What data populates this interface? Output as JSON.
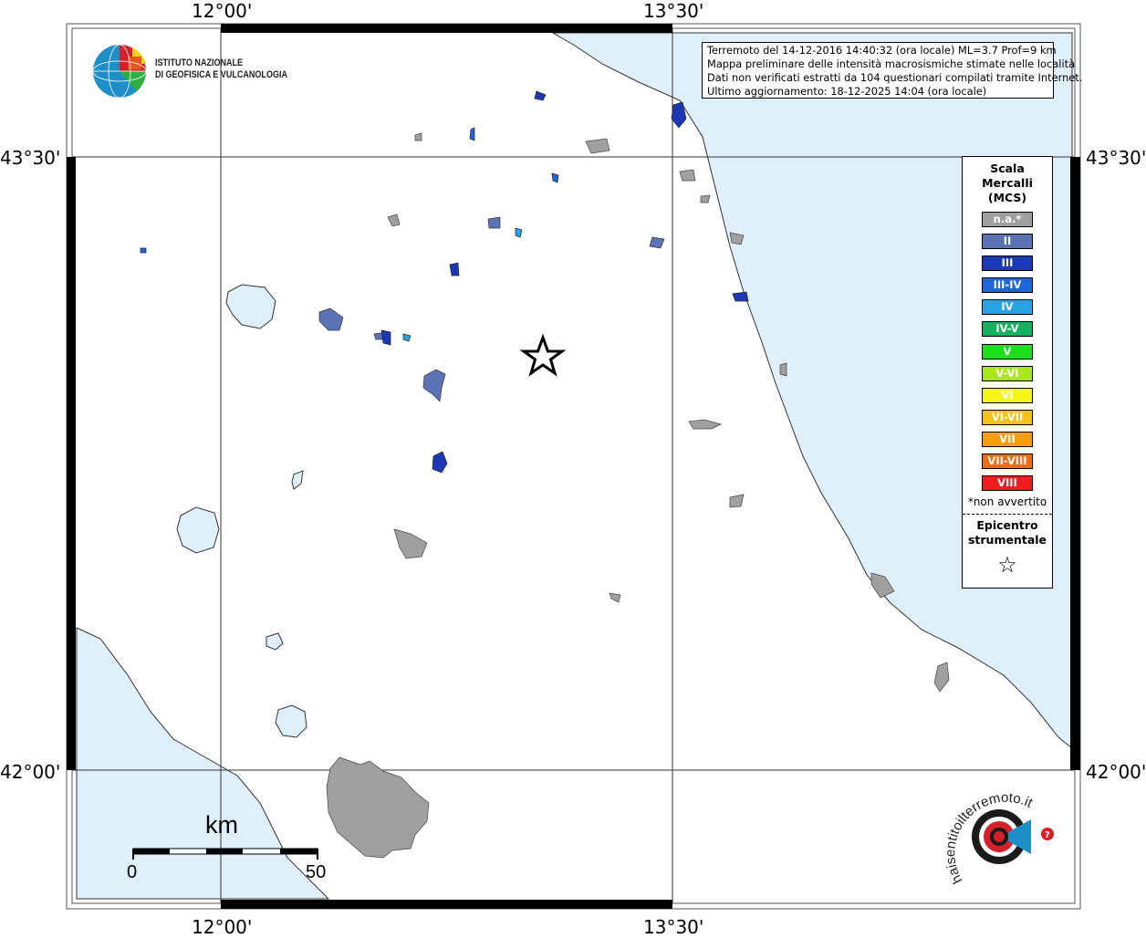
{
  "map": {
    "lon_labels": [
      "12°00'",
      "13°30'"
    ],
    "lat_labels": [
      "43°30'",
      "42°00'"
    ]
  },
  "info": {
    "lines": [
      "Terremoto del 14-12-2016 14:40:32 (ora locale) ML=3.7 Prof=9 km",
      "Mappa preliminare delle intensità macrosismiche stimate nelle località",
      "Dati non verificati estratti da 104 questionari compilati tramite Internet.",
      "Ultimo aggiornamento: 18-12-2025 14:04 (ora locale)"
    ]
  },
  "ingv": {
    "line1": "ISTITUTO NAZIONALE",
    "line2": "DI GEOFISICA E VULCANOLOGIA"
  },
  "legend": {
    "title": [
      "Scala",
      "Mercalli",
      "(MCS)"
    ],
    "items": [
      {
        "label": "n.a.*",
        "color": "#a0a0a0"
      },
      {
        "label": "II",
        "color": "#5b72b5"
      },
      {
        "label": "III",
        "color": "#1c38b4"
      },
      {
        "label": "III-IV",
        "color": "#1f66d6"
      },
      {
        "label": "IV",
        "color": "#2aa3e6"
      },
      {
        "label": "IV-V",
        "color": "#15b060"
      },
      {
        "label": "V",
        "color": "#1edc1e"
      },
      {
        "label": "V-VI",
        "color": "#aae61e"
      },
      {
        "label": "VI",
        "color": "#f5f51a"
      },
      {
        "label": "VI-VII",
        "color": "#f5c21a"
      },
      {
        "label": "VII",
        "color": "#f5a00a"
      },
      {
        "label": "VII-VIII",
        "color": "#f06c14"
      },
      {
        "label": "VIII",
        "color": "#f01e1e"
      }
    ],
    "note": "*non avvertito",
    "epicenter_label": [
      "Epicentro",
      "strumentale"
    ],
    "epicenter_symbol": "☆"
  },
  "scale": {
    "unit": "km",
    "min": "0",
    "max": "50"
  },
  "hsit": {
    "text": "haisentitoilterremoto.it",
    "url": "www."
  }
}
